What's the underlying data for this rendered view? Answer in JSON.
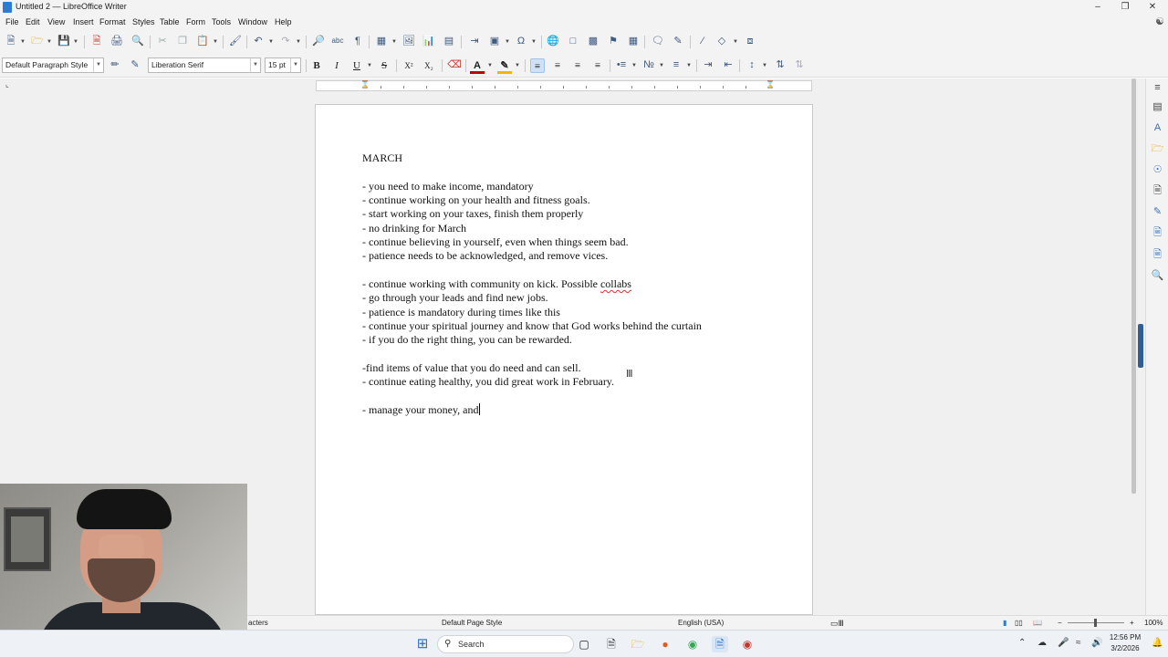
{
  "window": {
    "title": "Untitled 2 — LibreOffice Writer"
  },
  "menu": [
    "File",
    "Edit",
    "View",
    "Insert",
    "Format",
    "Styles",
    "Table",
    "Form",
    "Tools",
    "Window",
    "Help"
  ],
  "toolbar": {
    "paragraph_style": "Default Paragraph Style",
    "font_name": "Liberation Serif",
    "font_size": "15 pt",
    "bold": "B",
    "italic": "I",
    "underline": "U",
    "strike": "S",
    "superscript": "X²",
    "subscript": "X₂",
    "font_color": "#c00000",
    "highlight_color": "#f4b400"
  },
  "document": {
    "lines": [
      "MARCH",
      "- you need to make income, mandatory",
      "- continue working on your health and fitness goals.",
      "- start working on your taxes, finish them properly",
      "- no drinking for March",
      "- continue believing in yourself, even when things seem bad.",
      "- patience needs to be acknowledged, and remove vices.",
      "- continue working with community on kick. Possible ",
      "collabs",
      "- go through your leads and find new jobs.",
      "- patience is mandatory during times like this",
      "- continue your spiritual journey and know that God works behind the curtain",
      "- if you do the right thing, you can be rewarded.",
      "-find items of value that you do need and can sell.",
      "- continue eating healthy, you did great work in February.",
      "- manage your money, and"
    ]
  },
  "statusbar": {
    "word_count": "acters",
    "page_style": "Default Page Style",
    "language": "English (USA)",
    "zoom": "100%",
    "zoom_minus": "−",
    "zoom_plus": "+"
  },
  "taskbar": {
    "search_placeholder": "Search",
    "time": "12:56 PM",
    "date": "3/2/2026"
  },
  "colors": {
    "accent": "#2b7cd3",
    "chrome": "#f3f3f3",
    "spell_error": "#d9312b"
  }
}
